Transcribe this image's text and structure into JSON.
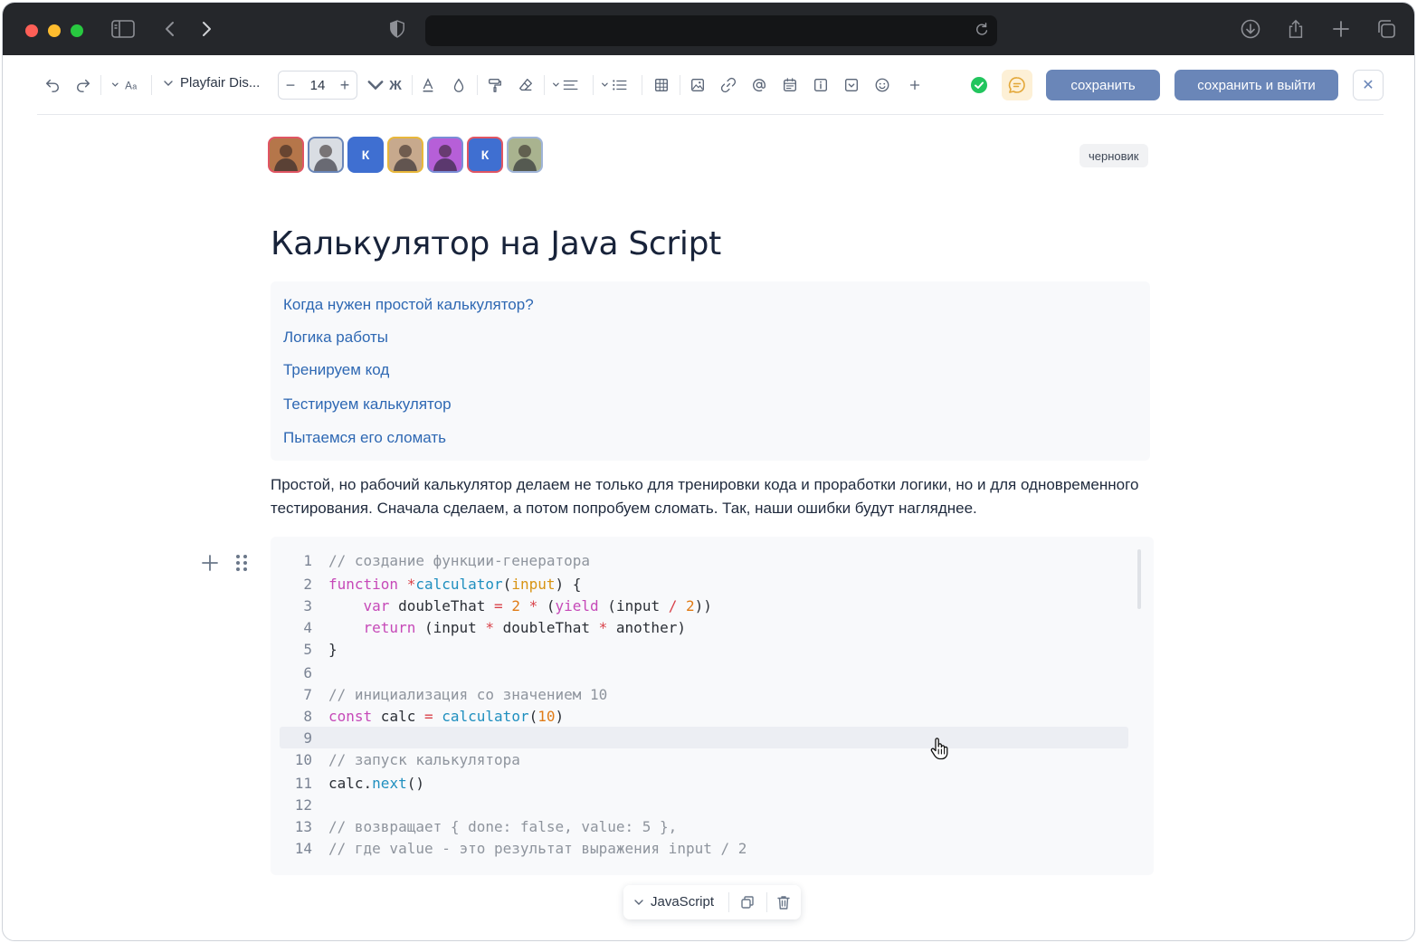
{
  "toolbar": {
    "font_name": "Playfair Dis...",
    "font_size": "14",
    "bold_label": "Ж",
    "save_label": "сохранить",
    "save_exit_label": "сохранить и выйти",
    "close_label": "✕"
  },
  "avatars": [
    {
      "kind": "photo",
      "border": "#e05563",
      "bg": "#b5764a"
    },
    {
      "kind": "photo",
      "border": "#6a86b8",
      "bg": "#d9dde3"
    },
    {
      "kind": "initial",
      "text": "К",
      "border": "#3f6fd1",
      "bg": "#3f6fd1"
    },
    {
      "kind": "photo",
      "border": "#e8b73a",
      "bg": "#c7a98d"
    },
    {
      "kind": "photo",
      "border": "#7a8dd6",
      "bg": "#b65fd8"
    },
    {
      "kind": "initial",
      "text": "К",
      "border": "#e05563",
      "bg": "#3f6fd1"
    },
    {
      "kind": "photo",
      "border": "#9fb4d8",
      "bg": "#a9b38f"
    }
  ],
  "status_badge": "черновик",
  "page_title": "Калькулятор на Java Script",
  "toc": [
    "Когда нужен простой калькулятор?",
    "Логика работы",
    "Тренируем код",
    "Тестируем калькулятор",
    "Пытаемся его сломать"
  ],
  "paragraph": "Простой, но рабочий калькулятор делаем не только для тренировки кода и проработки логики, но и для одновременного тестирования. Сначала сделаем, а потом попробуем сломать. Так, наши ошибки будут нагляднее.",
  "code": {
    "language": "JavaScript",
    "active_line": 9,
    "lines": [
      "// создание функции-генератора",
      "function *calculator(input) {",
      "    var doubleThat = 2 * (yield (input / 2))",
      "    return (input * doubleThat * another)",
      "}",
      "",
      "// инициализация со значением 10",
      "const calc = calculator(10)",
      "",
      "// запуск калькулятора",
      "calc.next()",
      "",
      "// возвращает { done: false, value: 5 },",
      "// где value - это результат выражения input / 2"
    ]
  },
  "colors": {
    "accent_button": "#6a86b8",
    "link": "#2e68b3",
    "keyword": "#c649b8",
    "function": "#1f8fbf",
    "number": "#e07b16"
  }
}
